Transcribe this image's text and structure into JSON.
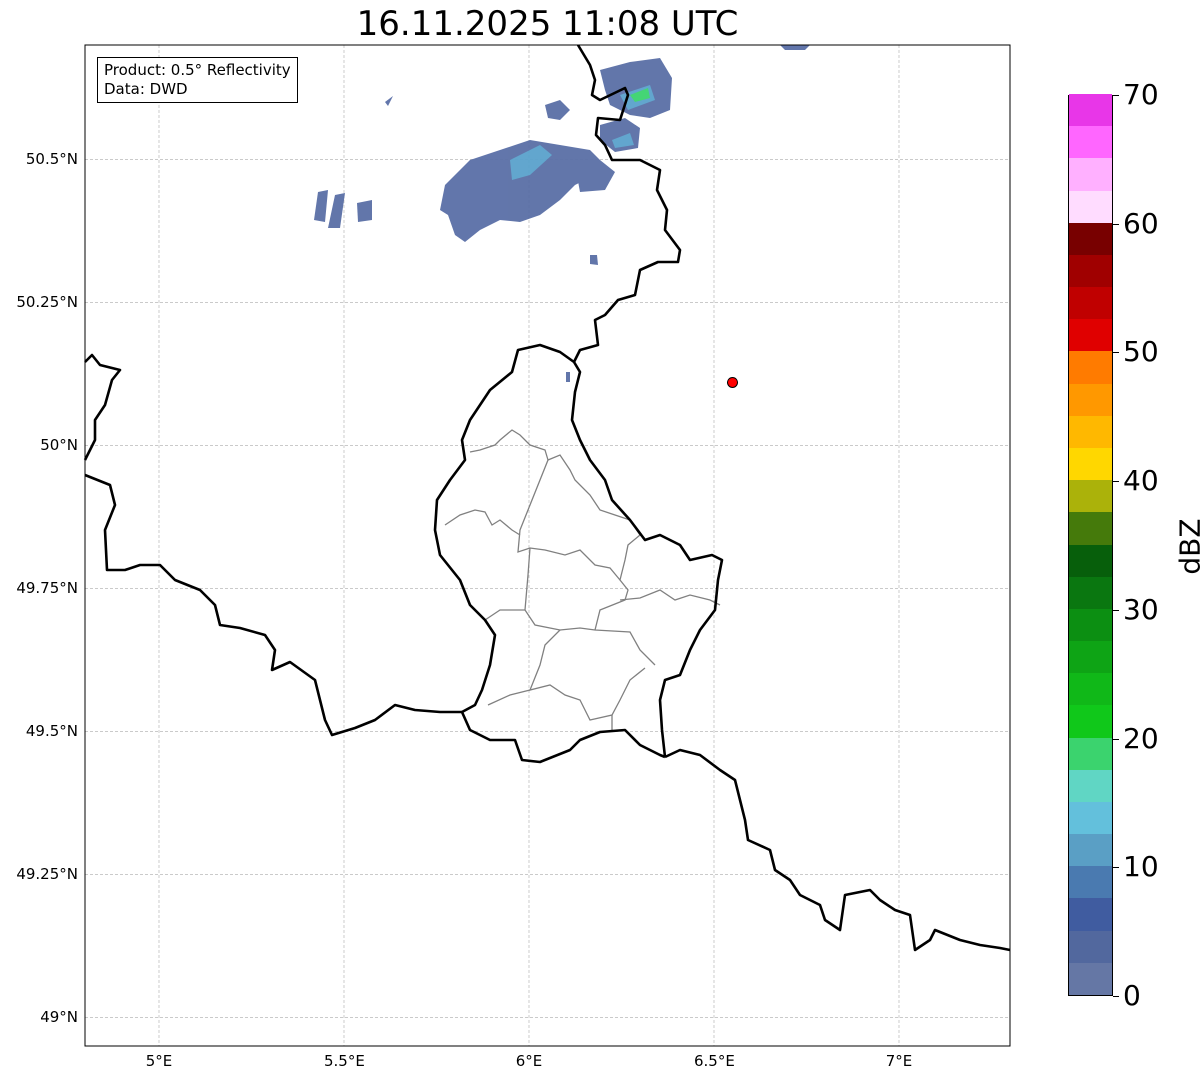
{
  "title": "16.11.2025 11:08 UTC",
  "legend": {
    "product": "Product: 0.5° Reflectivity",
    "source": "Data: DWD"
  },
  "map": {
    "extent": {
      "lon": [
        4.8,
        7.3
      ],
      "lat": [
        48.95,
        50.7
      ]
    },
    "lon_ticks": [
      {
        "value": 5,
        "label": "5°E"
      },
      {
        "value": 5.5,
        "label": "5.5°E"
      },
      {
        "value": 6,
        "label": "6°E"
      },
      {
        "value": 6.5,
        "label": "6.5°E"
      },
      {
        "value": 7,
        "label": "7°E"
      }
    ],
    "lat_ticks": [
      {
        "value": 50.5,
        "label": "50.5°N"
      },
      {
        "value": 50.25,
        "label": "50.25°N"
      },
      {
        "value": 50,
        "label": "50°N"
      },
      {
        "value": 49.75,
        "label": "49.75°N"
      },
      {
        "value": 49.5,
        "label": "49.5°N"
      },
      {
        "value": 49.25,
        "label": "49.25°N"
      },
      {
        "value": 49,
        "label": "49°N"
      }
    ],
    "grid": true,
    "radar_site": {
      "lon": 6.55,
      "lat": 50.11,
      "color": "#ff0000"
    }
  },
  "colorbar": {
    "unit": "dBZ",
    "range": [
      0,
      70
    ],
    "step": 2.5,
    "ticks": [
      "0",
      "10",
      "20",
      "30",
      "40",
      "50",
      "60",
      "70"
    ],
    "colors": [
      "#6577a5",
      "#52689e",
      "#405ca0",
      "#4a7ab0",
      "#5a9fc5",
      "#63c0dc",
      "#60d6c4",
      "#3bd36e",
      "#10c81a",
      "#10b818",
      "#0ea415",
      "#0c8f12",
      "#0a7710",
      "#075f0b",
      "#457a0b",
      "#abb20a",
      "#ffd700",
      "#ffb800",
      "#ff9800",
      "#ff7b00",
      "#e00000",
      "#c00000",
      "#a00000",
      "#780000",
      "#ffdcff",
      "#ffb0ff",
      "#ff66ff",
      "#e836e8"
    ]
  }
}
